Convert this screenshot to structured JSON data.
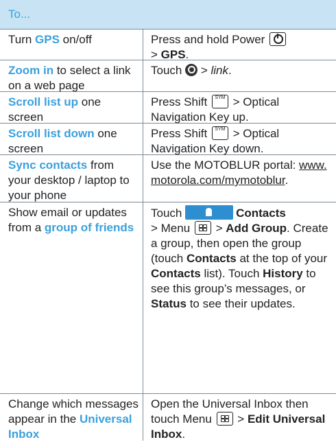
{
  "header": {
    "title": "To..."
  },
  "rows": [
    {
      "c1_pre": "Turn ",
      "c1_hl": "GPS",
      "c1_post": " on/off",
      "c2_pre": "Press and hold Power ",
      "c2_b1": "GPS",
      "c2_sep": "> ",
      "c2_end": "."
    },
    {
      "c1_hl": "Zoom in",
      "c1_post": " to select a link on a web page",
      "c2_pre": "Touch ",
      "c2_gt": " > ",
      "c2_it": "link",
      "c2_end": "."
    },
    {
      "c1_hl": "Scroll list up",
      "c1_post": " one screen",
      "c2_pre": "Press Shift ",
      "c2_post": " > Optical Navigation Key up.",
      "key_label": "SYM"
    },
    {
      "c1_hl": "Scroll list down",
      "c1_post": " one screen",
      "c2_pre": "Press Shift ",
      "c2_post": " > Optical Navigation Key down.",
      "key_label": "SYM"
    },
    {
      "c1_hl": "Sync contacts",
      "c1_post": " from your desktop / laptop to your phone",
      "c2_pre": "Use the MOTOBLUR portal: ",
      "c2_link": "www.motorola.com/mymotoblur",
      "c2_end": "."
    },
    {
      "c1_pre": "Show email or updates from a ",
      "c1_hl": "group of friends",
      "c2_a": "Touch ",
      "c2_b_contacts": "Contacts",
      "c2_c": "> Menu ",
      "c2_d": " > ",
      "c2_b_addgroup": "Add Group",
      "c2_e": ". Create a group, then open the group (touch ",
      "c2_b_contacts2": "Contacts",
      "c2_f": " at the top of your ",
      "c2_b_contacts3": "Contacts",
      "c2_g": " list). Touch ",
      "c2_b_history": "History",
      "c2_h": " to see this group’s messages, or ",
      "c2_b_status": "Status",
      "c2_i": " to see their updates."
    },
    {
      "c1_pre": "Change which messages appear in the ",
      "c1_hl": "Universal Inbox",
      "c2_a": "Open the Universal Inbox then touch Menu ",
      "c2_b": " > ",
      "c2_bold": "Edit Universal Inbox",
      "c2_end": "."
    }
  ]
}
